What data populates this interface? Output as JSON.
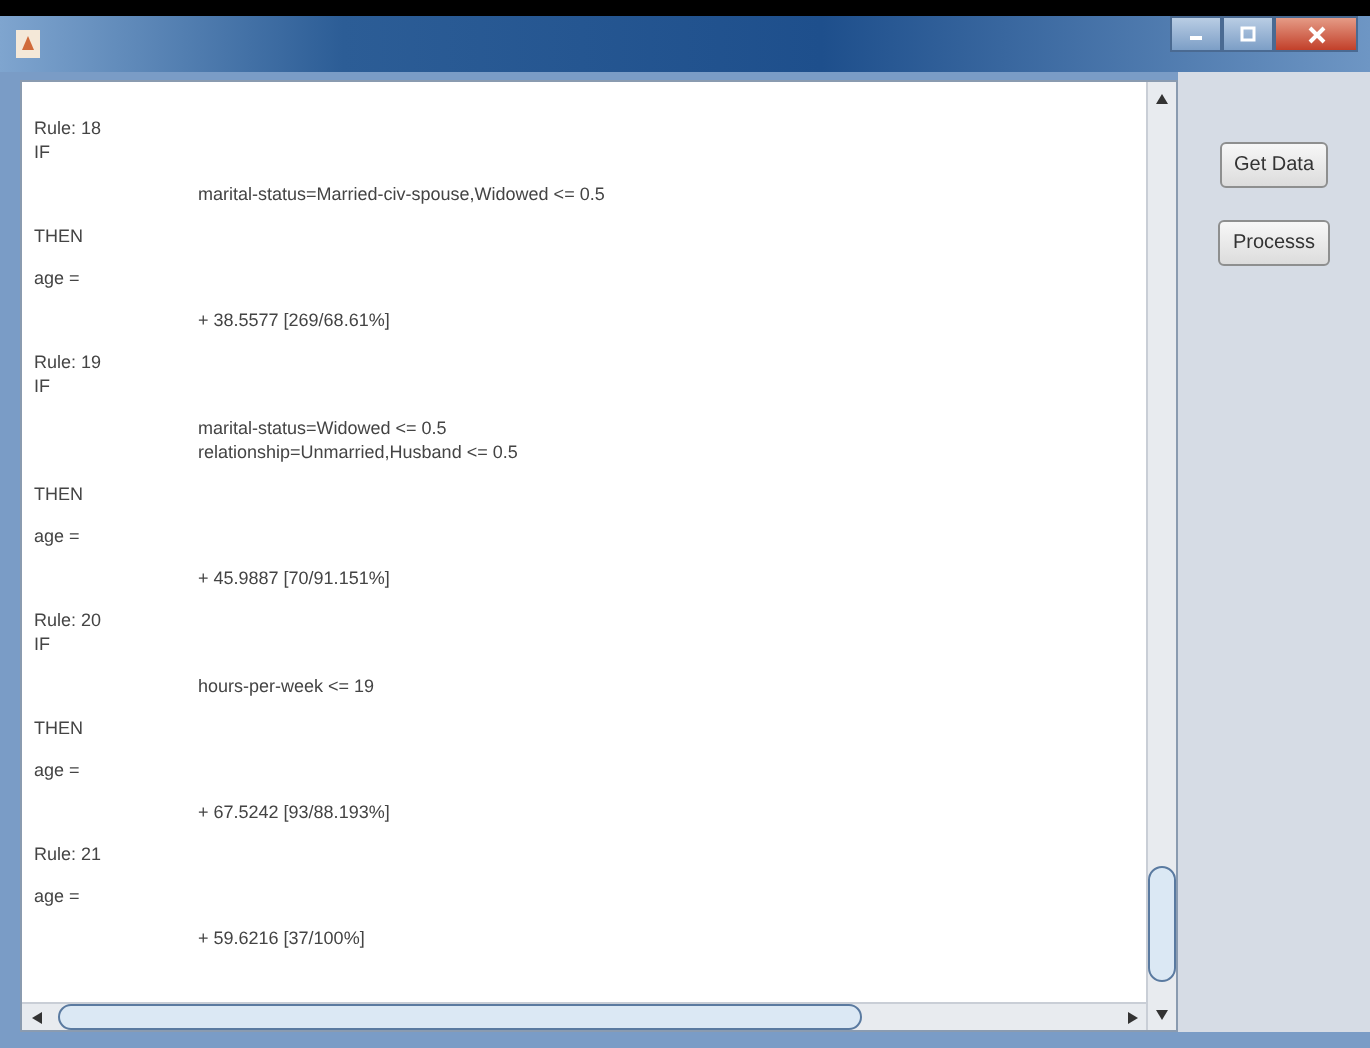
{
  "buttons": [
    "Get Data",
    "Processs"
  ],
  "lines": [
    {
      "kind": "label",
      "text": "Rule: 18"
    },
    {
      "kind": "keyword",
      "text": "IF"
    },
    {
      "kind": "condition",
      "text": "marital-status=Married-civ-spouse,Widowed <= 0.5"
    },
    {
      "kind": "label",
      "text": "THEN"
    },
    {
      "kind": "label",
      "text": "age ="
    },
    {
      "kind": "value",
      "text": "+ 38.5577 [269/68.61%]"
    },
    {
      "kind": "label",
      "text": "Rule: 19"
    },
    {
      "kind": "keyword",
      "text": "IF"
    },
    {
      "kind": "condition",
      "text": "marital-status=Widowed <= 0.5"
    },
    {
      "kind": "condition",
      "text": "relationship=Unmarried,Husband <= 0.5"
    },
    {
      "kind": "label",
      "text": "THEN"
    },
    {
      "kind": "label",
      "text": "age ="
    },
    {
      "kind": "value",
      "text": "+ 45.9887 [70/91.151%]"
    },
    {
      "kind": "label",
      "text": "Rule: 20"
    },
    {
      "kind": "keyword",
      "text": "IF"
    },
    {
      "kind": "condition",
      "text": "hours-per-week <= 19"
    },
    {
      "kind": "label",
      "text": "THEN"
    },
    {
      "kind": "label",
      "text": "age ="
    },
    {
      "kind": "value",
      "text": "+ 67.5242 [93/88.193%]"
    },
    {
      "kind": "label",
      "text": "Rule: 21"
    },
    {
      "kind": "label",
      "text": "age ="
    },
    {
      "kind": "value",
      "text": "+ 59.6216 [37/100%]"
    }
  ]
}
